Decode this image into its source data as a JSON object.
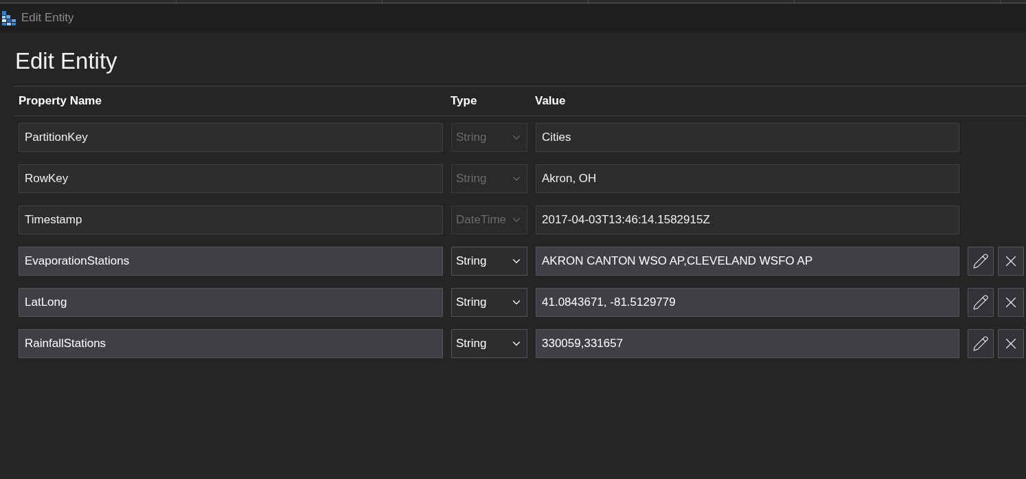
{
  "window": {
    "title": "Edit Entity"
  },
  "heading": "Edit Entity",
  "table": {
    "columns": [
      "Property Name",
      "Type",
      "Value"
    ],
    "rows": [
      {
        "name": "PartitionKey",
        "type": "String",
        "value": "Cities",
        "editable": false
      },
      {
        "name": "RowKey",
        "type": "String",
        "value": "Akron, OH",
        "editable": false
      },
      {
        "name": "Timestamp",
        "type": "DateTime",
        "value": "2017-04-03T13:46:14.1582915Z",
        "editable": false
      },
      {
        "name": "EvaporationStations",
        "type": "String",
        "value": "AKRON CANTON WSO AP,CLEVELAND WSFO AP",
        "editable": true
      },
      {
        "name": "LatLong",
        "type": "String",
        "value": "41.0843671, -81.5129779",
        "editable": true
      },
      {
        "name": "RainfallStations",
        "type": "String",
        "value": "330059,331657",
        "editable": true
      }
    ]
  }
}
